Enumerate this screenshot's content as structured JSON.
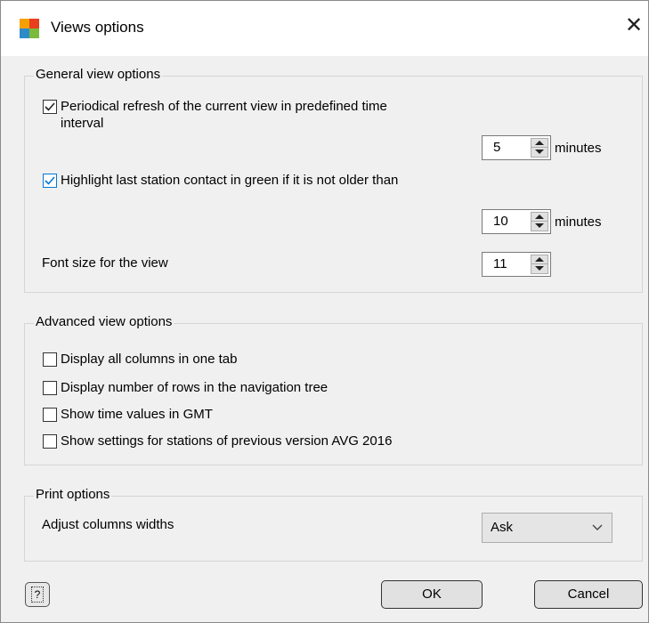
{
  "window": {
    "title": "Views options",
    "close_glyph": "✕"
  },
  "general": {
    "group_label": "General view options",
    "refresh": {
      "label_line1": "Periodical refresh of the current view in predefined time",
      "label_line2": "interval",
      "checked": true
    },
    "refresh_interval": {
      "value": "5",
      "unit": "minutes"
    },
    "highlight": {
      "label": "Highlight last station contact in green if it is not older than",
      "checked": true
    },
    "highlight_interval": {
      "value": "10",
      "unit": "minutes"
    },
    "font_size": {
      "label": "Font size for the view",
      "value": "11"
    }
  },
  "advanced": {
    "group_label": "Advanced view options",
    "items": [
      {
        "label": "Display all columns in one tab",
        "checked": false
      },
      {
        "label": "Display number of rows in the navigation tree",
        "checked": false
      },
      {
        "label": "Show time values in GMT",
        "checked": false
      },
      {
        "label": "Show settings for stations of previous version AVG 2016",
        "checked": false
      }
    ]
  },
  "print": {
    "group_label": "Print options",
    "adjust_label": "Adjust columns widths",
    "adjust_value": "Ask"
  },
  "footer": {
    "help_glyph": "?",
    "ok_label": "OK",
    "cancel_label": "Cancel"
  },
  "icons": [
    "avg-logo-icon",
    "close-icon",
    "checkmark-icon",
    "spinner-up-icon",
    "spinner-down-icon",
    "chevron-down-icon",
    "help-icon"
  ],
  "colors": {
    "checkbox_focus": "#0078d7",
    "dialog_bg": "#f0f0f0",
    "title_bg": "#ffffff"
  }
}
